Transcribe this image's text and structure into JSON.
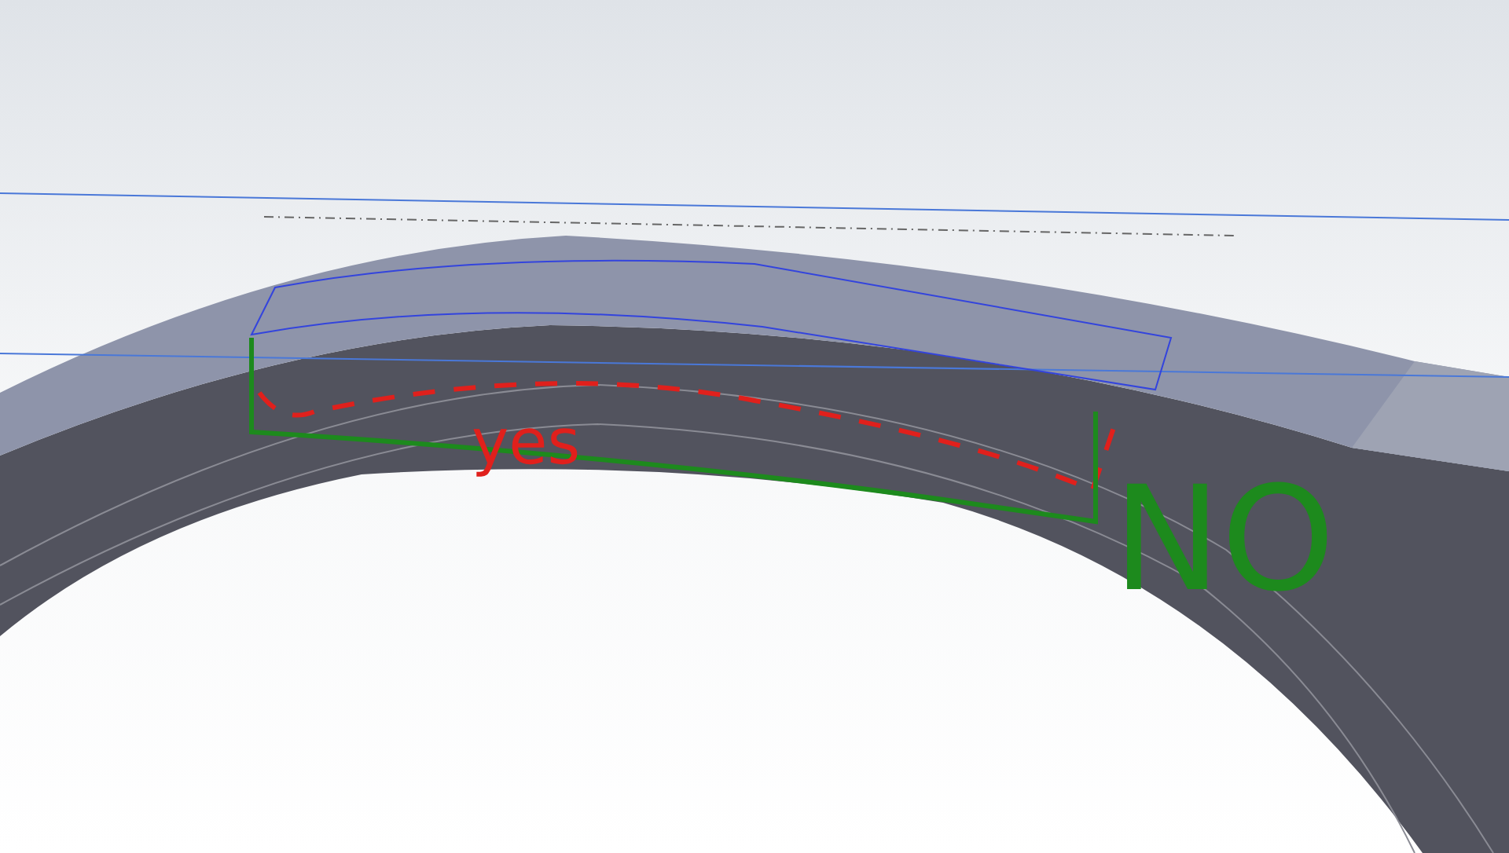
{
  "annotations": [
    {
      "text": "yes",
      "color": "#e0201c"
    },
    {
      "text": "NO",
      "color": "#1d8a1d"
    }
  ]
}
